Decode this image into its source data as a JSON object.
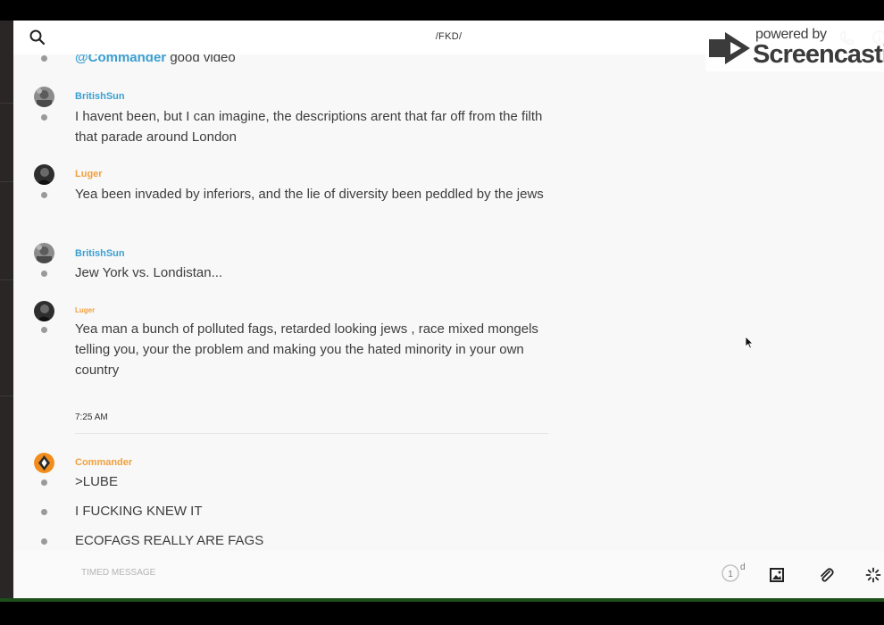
{
  "header": {
    "channel_title": "/FKD/"
  },
  "watermark": {
    "powered_by": "powered by",
    "brand": "Screencastify"
  },
  "messages": [
    {
      "user": "",
      "text_mention": "@Commander",
      "text": " good video"
    },
    {
      "user": "BritishSun",
      "text": "I havent been, but I can imagine, the descriptions arent that far off from the filth that parade around London"
    },
    {
      "user": "Luger",
      "text": "Yea  been invaded by inferiors, and the lie of diversity been peddled by the jews"
    },
    {
      "user": "BritishSun",
      "text": "Jew York vs. Londistan..."
    },
    {
      "user": "Luger",
      "text": "Yea man a bunch of polluted fags, retarded looking jews , race mixed mongels telling you, your the problem and making you the hated minority in your own country"
    }
  ],
  "separator": {
    "time": "7:25 AM"
  },
  "commander_block": {
    "user": "Commander",
    "lines": [
      ">LUBE",
      "I FUCKING KNEW IT",
      "ECOFAGS REALLY ARE FAGS"
    ]
  },
  "composer": {
    "placeholder": "TIMED MESSAGE",
    "timer_value": "1",
    "timer_unit": "d"
  },
  "icons": {
    "search": "search-icon",
    "phone": "phone-icon",
    "info": "info-icon",
    "timer": "timer-icon",
    "image": "image-icon",
    "attach": "paperclip-icon",
    "more": "spinner-icon"
  },
  "colors": {
    "username_blue": "#3b9fd1",
    "username_orange": "#f0a040",
    "app_bg": "#f8f8f8"
  }
}
